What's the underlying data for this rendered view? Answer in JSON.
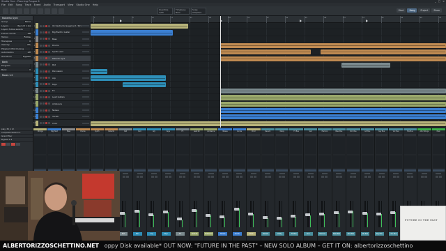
{
  "window": {
    "title": "Studio One - Planning Prague 6",
    "controls": [
      "_",
      "□",
      "✕"
    ]
  },
  "menu": [
    "File",
    "Edit",
    "Song",
    "Track",
    "Event",
    "Audio",
    "Transport",
    "View",
    "Studio One",
    "Help"
  ],
  "toolbar": {
    "field1": "Quantize 1/16",
    "field2": "Timebase Bars",
    "field3": "Snap Adaptive",
    "tabs": [
      {
        "label": "Start",
        "active": false
      },
      {
        "label": "Song",
        "active": true
      },
      {
        "label": "Project",
        "active": false
      },
      {
        "label": "Show",
        "active": false
      }
    ]
  },
  "inspector": {
    "title": "Roberto Synt",
    "rows": [
      {
        "k": "Group",
        "v": "None"
      },
      {
        "k": "Layers",
        "v": "Record 1 (A)"
      },
      {
        "k": "Layers follow events",
        "v": ""
      },
      {
        "k": "Follow chords",
        "v": "Off"
      },
      {
        "k": "Tempo",
        "v": "Follow"
      },
      {
        "k": "Transpose",
        "v": "0"
      },
      {
        "k": "Velocity",
        "v": "0%"
      },
      {
        "k": "Playback Microtuning",
        "v": ""
      },
      {
        "k": "Automation",
        "v": "Off"
      },
      {
        "k": "Transform",
        "v": "Bypass"
      }
    ],
    "section": "Bank",
    "rows2": [
      {
        "k": "Program",
        "v": ""
      },
      {
        "k": "Bank",
        "v": "0"
      }
    ],
    "preset": "Roses 1.2"
  },
  "tracks": [
    {
      "n": "1",
      "label": "Orchestral Arrangement / Strings",
      "color": "#b7b37a"
    },
    {
      "n": "2",
      "label": "Big Electric Guitar",
      "color": "#3b7fd1"
    },
    {
      "n": "3",
      "label": "Bass",
      "color": "#8b8b8b"
    },
    {
      "n": "4",
      "label": "Drums",
      "color": "#c08b52"
    },
    {
      "n": "5",
      "label": "Synth Lead",
      "color": "#c08b52"
    },
    {
      "n": "6",
      "label": "Roberto Synt",
      "color": "#c08b52",
      "selected": true
    },
    {
      "n": "7",
      "label": "Pad",
      "color": "#7b8a8e"
    },
    {
      "n": "8",
      "label": "Percussion",
      "color": "#2e8fb8"
    },
    {
      "n": "9",
      "label": "Arp",
      "color": "#2e8fb8"
    },
    {
      "n": "10",
      "label": "Keys",
      "color": "#2e8fb8"
    },
    {
      "n": "11",
      "label": "FX",
      "color": "#7b8a8e"
    },
    {
      "n": "12",
      "label": "Lead Guitars",
      "color": "#9aa86b"
    },
    {
      "n": "13",
      "label": "Ambience",
      "color": "#9aa86b"
    },
    {
      "n": "14",
      "label": "Noises",
      "color": "#3b7fd1"
    },
    {
      "n": "15",
      "label": "Vocals",
      "color": "#3b7fd1"
    },
    {
      "n": "16",
      "label": "Choir",
      "color": "#b7b37a"
    }
  ],
  "ruler": [
    "1",
    "5",
    "9",
    "13",
    "17",
    "21",
    "25",
    "29",
    "33",
    "37",
    "41",
    "45",
    "49",
    "53",
    "57",
    "61",
    "65",
    "69",
    "73"
  ],
  "mixer": {
    "left_rows": [
      "play_30_1 ch",
      "Complete Section 2",
      "Grand Tour",
      "Bypass 1.4"
    ],
    "channels": [
      {
        "name": "Strings",
        "color": "#b7b37a",
        "level": 0.55
      },
      {
        "name": "Big Elect",
        "color": "#3b7fd1",
        "level": 0.6
      },
      {
        "name": "Bass",
        "color": "#8b8b8b",
        "level": 0.45
      },
      {
        "name": "Drums",
        "color": "#c08b52",
        "level": 0.7
      },
      {
        "name": "Synth",
        "color": "#c08b52",
        "level": 0.5
      },
      {
        "name": "Roberto",
        "color": "#c08b52",
        "level": 0.4
      },
      {
        "name": "Pad",
        "color": "#7b8a8e",
        "level": 0.52
      },
      {
        "name": "Perc",
        "color": "#2e8fb8",
        "level": 0.62
      },
      {
        "name": "Arp",
        "color": "#2e8fb8",
        "level": 0.48
      },
      {
        "name": "Keys",
        "color": "#2e8fb8",
        "level": 0.58
      },
      {
        "name": "FX",
        "color": "#7b8a8e",
        "level": 0.3
      },
      {
        "name": "Lead Gt",
        "color": "#9aa86b",
        "level": 0.66
      },
      {
        "name": "Ambience",
        "color": "#9aa86b",
        "level": 0.44
      },
      {
        "name": "Noises",
        "color": "#3b7fd1",
        "level": 0.38
      },
      {
        "name": "Vocals",
        "color": "#3b7fd1",
        "level": 0.72
      },
      {
        "name": "Choir",
        "color": "#b7b37a",
        "level": 0.5
      },
      {
        "name": "Reverb",
        "color": "#4a8f9e",
        "level": 0.35
      },
      {
        "name": "Delay",
        "color": "#4a8f9e",
        "level": 0.33
      },
      {
        "name": "FX Bus",
        "color": "#4a8f9e",
        "level": 0.4
      },
      {
        "name": "Sub",
        "color": "#4a8f9e",
        "level": 0.46
      },
      {
        "name": "Harmon",
        "color": "#4a8f9e",
        "level": 0.5
      },
      {
        "name": "Bass Bus",
        "color": "#4a8f9e",
        "level": 0.55
      },
      {
        "name": "Drm Bus",
        "color": "#4a8f9e",
        "level": 0.6
      },
      {
        "name": "Gtr Bus",
        "color": "#4a8f9e",
        "level": 0.52
      },
      {
        "name": "Key Bus",
        "color": "#4a8f9e",
        "level": 0.49
      },
      {
        "name": "Voc Bus",
        "color": "#4a8f9e",
        "level": 0.57
      },
      {
        "name": "Mix Bus",
        "color": "#4a8f9e",
        "level": 0.63
      },
      {
        "name": "Alto Strings",
        "color": "#3bb04a",
        "level": 0.5
      },
      {
        "name": "Main",
        "color": "#3bb04a",
        "level": 0.75
      }
    ]
  },
  "album": {
    "title": "FUTURE IN THE PAST"
  },
  "ticker": {
    "brand": "ALBERTORIZZOSCHETTINO.NET",
    "message": "oppy Disk available* OUT NOW: \"FUTURE IN THE PAST\" – NEW SOLO ALBUM – GET IT ON: albertorizzoschettino"
  }
}
